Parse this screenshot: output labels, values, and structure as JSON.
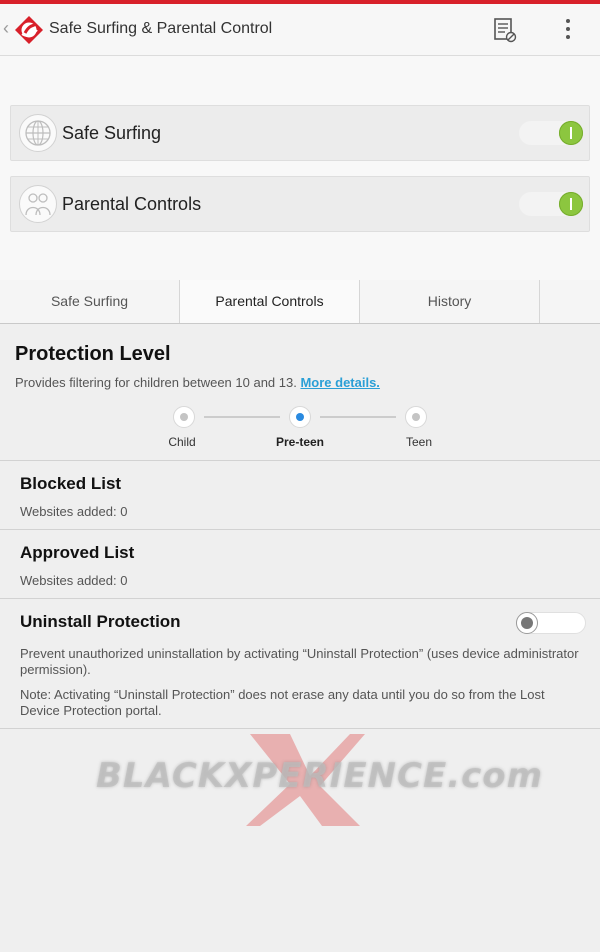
{
  "header": {
    "title": "Safe Surfing & Parental Control",
    "back_glyph": "‹",
    "logo_icon": "trend-micro-logo",
    "actions": [
      "document-icon",
      "overflow-menu-icon"
    ]
  },
  "features": [
    {
      "label": "Safe Surfing",
      "icon": "globe-icon",
      "enabled": true
    },
    {
      "label": "Parental Controls",
      "icon": "family-icon",
      "enabled": true
    }
  ],
  "tabs": [
    {
      "label": "Safe Surfing",
      "active": false
    },
    {
      "label": "Parental Controls",
      "active": true
    },
    {
      "label": "History",
      "active": false
    }
  ],
  "protection": {
    "title": "Protection Level",
    "description": "Provides filtering for children between 10 and 13. ",
    "more_link": "More details.",
    "levels": [
      "Child",
      "Pre-teen",
      "Teen"
    ],
    "selected_level": "Pre-teen"
  },
  "blocked": {
    "title": "Blocked List",
    "subtitle": "Websites added: 0"
  },
  "approved": {
    "title": "Approved List",
    "subtitle": "Websites added: 0"
  },
  "uninstall": {
    "title": "Uninstall Protection",
    "enabled": false,
    "description": "Prevent unauthorized uninstallation by activating “Uninstall Protection” (uses device administrator permission).",
    "note": "Note: Activating “Uninstall Protection” does not erase any data until you do so from the Lost Device Protection portal."
  },
  "watermark": {
    "text": "BLACKXPERIENCE.com"
  },
  "colors": {
    "accent_red": "#d8202a",
    "toggle_on": "#8cc63f",
    "link": "#2a9fd6",
    "selected_step": "#2a8ae0"
  }
}
